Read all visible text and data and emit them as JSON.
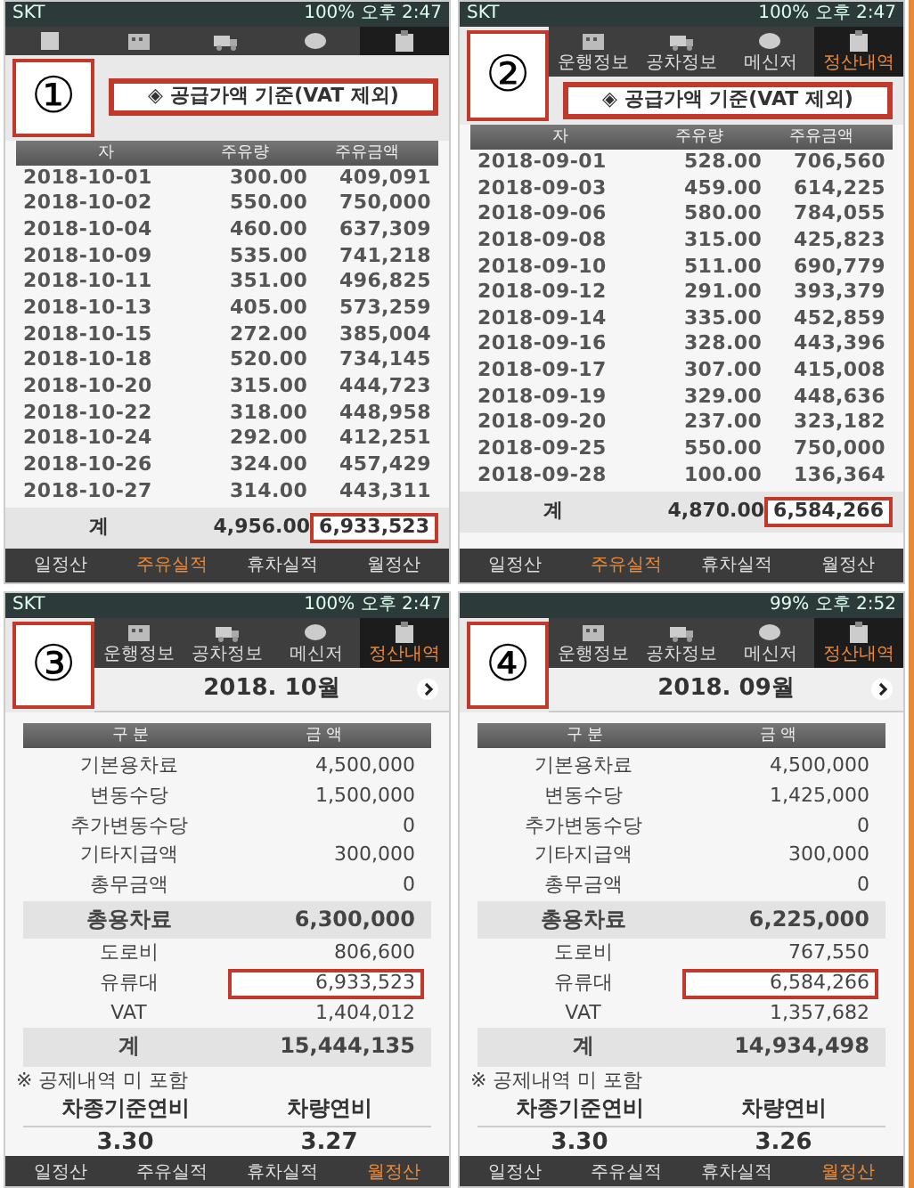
{
  "panels": [
    {
      "kind": "fuel",
      "number": "①",
      "status": {
        "carrier": "SKT",
        "battery": "100%",
        "time": "오후 2:47"
      },
      "tabs": [
        {
          "selected": false
        },
        {
          "selected": false
        },
        {
          "selected": false
        },
        {
          "selected": false
        },
        {
          "selected": true
        }
      ],
      "notice": "◈ 공급가액 기준(VAT 제외)",
      "columns": [
        "자",
        "주유량",
        "주유금액"
      ],
      "rows": [
        [
          "2018-10-01",
          "300.00",
          "409,091"
        ],
        [
          "2018-10-02",
          "550.00",
          "750,000"
        ],
        [
          "2018-10-04",
          "460.00",
          "637,309"
        ],
        [
          "2018-10-09",
          "535.00",
          "741,218"
        ],
        [
          "2018-10-11",
          "351.00",
          "496,825"
        ],
        [
          "2018-10-13",
          "405.00",
          "573,259"
        ],
        [
          "2018-10-15",
          "272.00",
          "385,004"
        ],
        [
          "2018-10-18",
          "520.00",
          "734,145"
        ],
        [
          "2018-10-20",
          "315.00",
          "444,723"
        ],
        [
          "2018-10-22",
          "318.00",
          "448,958"
        ],
        [
          "2018-10-24",
          "292.00",
          "412,251"
        ],
        [
          "2018-10-26",
          "324.00",
          "457,429"
        ],
        [
          "2018-10-27",
          "314.00",
          "443,311"
        ]
      ],
      "total": {
        "label": "계",
        "amount": "4,956.00",
        "sum": "6,933,523",
        "highlighted": true
      },
      "bottom_nav": [
        {
          "label": "일정산",
          "selected": false
        },
        {
          "label": "주유실적",
          "selected": true
        },
        {
          "label": "휴차실적",
          "selected": false
        },
        {
          "label": "월정산",
          "selected": false
        }
      ]
    },
    {
      "kind": "fuel",
      "number": "②",
      "status": {
        "carrier": "SKT",
        "battery": "100%",
        "time": "오후 2:47"
      },
      "tabs": [
        {
          "label": "운행정보",
          "selected": false
        },
        {
          "label": "공차정보",
          "selected": false
        },
        {
          "label": "메신저",
          "selected": false
        },
        {
          "label": "정산내역",
          "selected": true
        }
      ],
      "notice": "◈ 공급가액 기준(VAT 제외)",
      "columns": [
        "자",
        "주유량",
        "주유금액"
      ],
      "rows": [
        [
          "2018-09-01",
          "528.00",
          "706,560"
        ],
        [
          "2018-09-03",
          "459.00",
          "614,225"
        ],
        [
          "2018-09-06",
          "580.00",
          "784,055"
        ],
        [
          "2018-09-08",
          "315.00",
          "425,823"
        ],
        [
          "2018-09-10",
          "511.00",
          "690,779"
        ],
        [
          "2018-09-12",
          "291.00",
          "393,379"
        ],
        [
          "2018-09-14",
          "335.00",
          "452,859"
        ],
        [
          "2018-09-16",
          "328.00",
          "443,396"
        ],
        [
          "2018-09-17",
          "307.00",
          "415,008"
        ],
        [
          "2018-09-19",
          "329.00",
          "448,636"
        ],
        [
          "2018-09-20",
          "237.00",
          "323,182"
        ],
        [
          "2018-09-25",
          "550.00",
          "750,000"
        ],
        [
          "2018-09-28",
          "100.00",
          "136,364"
        ]
      ],
      "total": {
        "label": "계",
        "amount": "4,870.00",
        "sum": "6,584,266",
        "highlighted": true
      },
      "bottom_nav": [
        {
          "label": "일정산",
          "selected": false
        },
        {
          "label": "주유실적",
          "selected": true
        },
        {
          "label": "휴차실적",
          "selected": false
        },
        {
          "label": "월정산",
          "selected": false
        }
      ]
    },
    {
      "kind": "settlement",
      "number": "③",
      "status": {
        "carrier": "SKT",
        "battery": "100%",
        "time": "오후 2:47"
      },
      "tabs": [
        {
          "label": "운행정보",
          "selected": false
        },
        {
          "label": "공차정보",
          "selected": false
        },
        {
          "label": "메신저",
          "selected": false
        },
        {
          "label": "정산내역",
          "selected": true
        }
      ],
      "month": "2018. 10월",
      "columns": [
        "구 분",
        "금 액"
      ],
      "rows": [
        {
          "kind": "item",
          "label": "기본용차료",
          "value": "4,500,000",
          "highlighted": false
        },
        {
          "kind": "item",
          "label": "변동수당",
          "value": "1,500,000",
          "highlighted": false
        },
        {
          "kind": "item",
          "label": "추가변동수당",
          "value": "0",
          "highlighted": false
        },
        {
          "kind": "item",
          "label": "기타지급액",
          "value": "300,000",
          "highlighted": false
        },
        {
          "kind": "item",
          "label": "총무금액",
          "value": "0",
          "highlighted": false
        },
        {
          "kind": "total",
          "label": "총용차료",
          "value": "6,300,000",
          "highlighted": false
        },
        {
          "kind": "item",
          "label": "도로비",
          "value": "806,600",
          "highlighted": false
        },
        {
          "kind": "item",
          "label": "유류대",
          "value": "6,933,523",
          "highlighted": true
        },
        {
          "kind": "item",
          "label": "VAT",
          "value": "1,404,012",
          "highlighted": false
        },
        {
          "kind": "total",
          "label": "계",
          "value": "15,444,135",
          "highlighted": false
        }
      ],
      "note": "※ 공제내역 미 포함",
      "efficiency": [
        {
          "label": "차종기준연비",
          "value": "3.30"
        },
        {
          "label": "차량연비",
          "value": "3.27"
        }
      ],
      "bottom_nav": [
        {
          "label": "일정산",
          "selected": false
        },
        {
          "label": "주유실적",
          "selected": false
        },
        {
          "label": "휴차실적",
          "selected": false
        },
        {
          "label": "월정산",
          "selected": true
        }
      ]
    },
    {
      "kind": "settlement",
      "number": "④",
      "status": {
        "battery": "99%",
        "time": "오후 2:52"
      },
      "tabs": [
        {
          "label": "운행정보",
          "selected": false
        },
        {
          "label": "공차정보",
          "selected": false
        },
        {
          "label": "메신저",
          "selected": false
        },
        {
          "label": "정산내역",
          "selected": true
        }
      ],
      "month": "2018. 09월",
      "columns": [
        "구 분",
        "금 액"
      ],
      "rows": [
        {
          "kind": "item",
          "label": "기본용차료",
          "value": "4,500,000",
          "highlighted": false
        },
        {
          "kind": "item",
          "label": "변동수당",
          "value": "1,425,000",
          "highlighted": false
        },
        {
          "kind": "item",
          "label": "추가변동수당",
          "value": "0",
          "highlighted": false
        },
        {
          "kind": "item",
          "label": "기타지급액",
          "value": "300,000",
          "highlighted": false
        },
        {
          "kind": "item",
          "label": "총무금액",
          "value": "0",
          "highlighted": false
        },
        {
          "kind": "total",
          "label": "총용차료",
          "value": "6,225,000",
          "highlighted": false
        },
        {
          "kind": "item",
          "label": "도로비",
          "value": "767,550",
          "highlighted": false
        },
        {
          "kind": "item",
          "label": "유류대",
          "value": "6,584,266",
          "highlighted": true
        },
        {
          "kind": "item",
          "label": "VAT",
          "value": "1,357,682",
          "highlighted": false
        },
        {
          "kind": "total",
          "label": "계",
          "value": "14,934,498",
          "highlighted": false
        }
      ],
      "note": "※ 공제내역 미 포함",
      "efficiency": [
        {
          "label": "차종기준연비",
          "value": "3.30"
        },
        {
          "label": "차량연비",
          "value": "3.26"
        }
      ],
      "bottom_nav": [
        {
          "label": "일정산",
          "selected": false
        },
        {
          "label": "주유실적",
          "selected": false
        },
        {
          "label": "휴차실적",
          "selected": false
        },
        {
          "label": "월정산",
          "selected": true
        }
      ]
    }
  ]
}
